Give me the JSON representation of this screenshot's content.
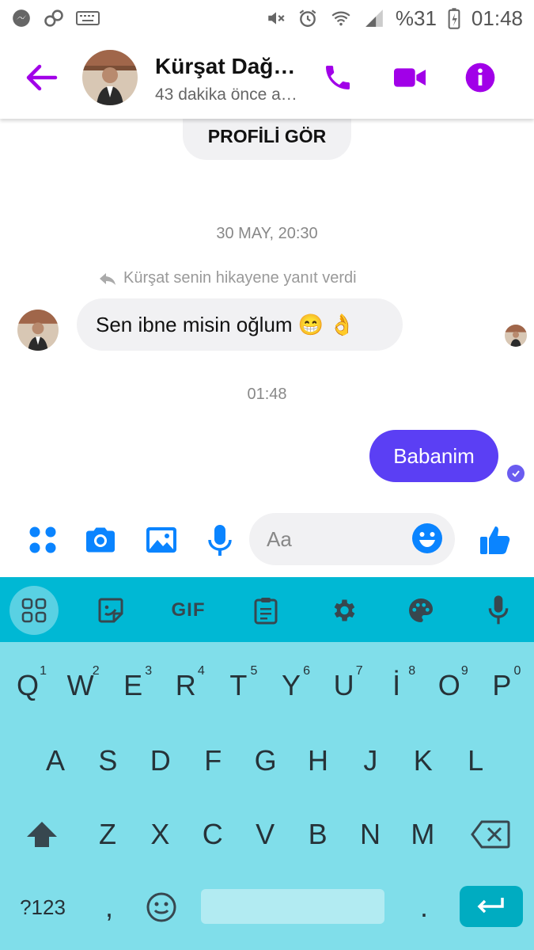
{
  "status_bar": {
    "battery": "%31",
    "time": "01:48"
  },
  "header": {
    "contact_name": "Kürşat Dağa…",
    "contact_status": "43 dakika önce a…"
  },
  "chat": {
    "profile_button": "PROFİLİ GÖR",
    "date1": "30 MAY, 20:30",
    "reply_note": "Kürşat senin hikayene yanıt verdi",
    "incoming_message": "Sen ibne misin oğlum 😁 👌",
    "date2": "01:48",
    "outgoing_message": "Babanim"
  },
  "composer": {
    "placeholder": "Aa"
  },
  "keyboard": {
    "toolbar": [
      "apps",
      "sticker",
      "GIF",
      "clipboard",
      "settings",
      "theme",
      "mic"
    ],
    "gif_label": "GIF",
    "row1": [
      {
        "k": "Q",
        "n": "1"
      },
      {
        "k": "W",
        "n": "2"
      },
      {
        "k": "E",
        "n": "3"
      },
      {
        "k": "R",
        "n": "4"
      },
      {
        "k": "T",
        "n": "5"
      },
      {
        "k": "Y",
        "n": "6"
      },
      {
        "k": "U",
        "n": "7"
      },
      {
        "k": "İ",
        "n": "8"
      },
      {
        "k": "O",
        "n": "9"
      },
      {
        "k": "P",
        "n": "0"
      }
    ],
    "row2": [
      "A",
      "S",
      "D",
      "F",
      "G",
      "H",
      "J",
      "K",
      "L"
    ],
    "row3": [
      "Z",
      "X",
      "C",
      "V",
      "B",
      "N",
      "M"
    ],
    "symbols_label": "?123",
    "comma": ",",
    "period": "."
  },
  "colors": {
    "accent_purple": "#a100e8",
    "bubble_out": "#5b3ff4",
    "messenger_blue": "#0a84ff",
    "keyboard_bg": "#80deea",
    "keyboard_toolbar": "#00b8d4"
  }
}
